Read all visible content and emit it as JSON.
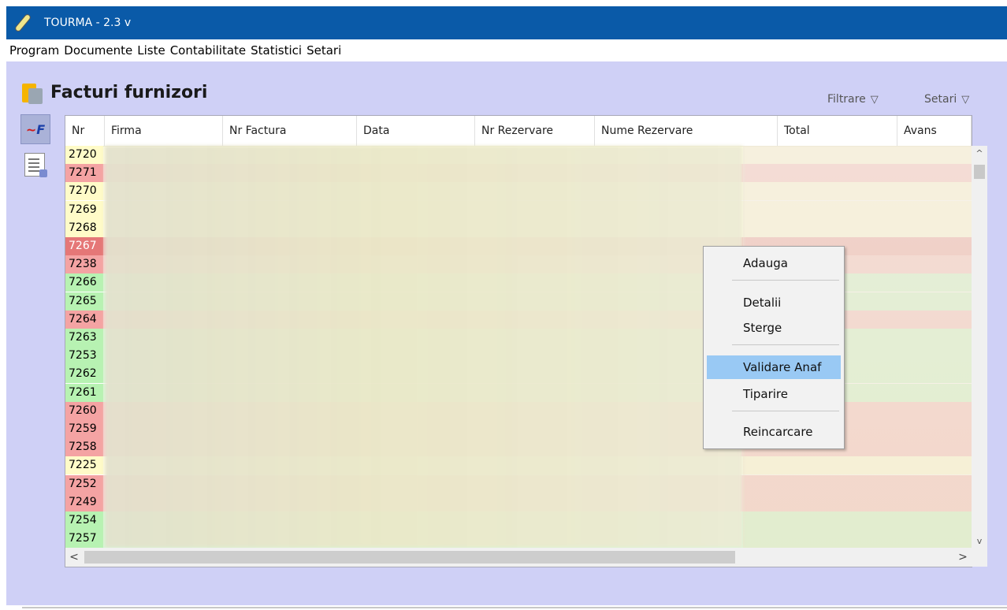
{
  "window": {
    "title": "TOURMA - 2.3 v",
    "icon": "feather-pen-icon"
  },
  "menubar": {
    "items": [
      "Program",
      "Documente",
      "Liste",
      "Contabilitate",
      "Statistici",
      "Setari"
    ]
  },
  "page": {
    "title": "Facturi furnizori",
    "title_icon": "folder-icon",
    "filter_label": "Filtrare",
    "settings_label": "Setari",
    "dropdown_glyph": "▽"
  },
  "sidebar": {
    "tools": [
      {
        "name": "anaf-logo-icon",
        "label": "AF"
      },
      {
        "name": "document-edit-icon"
      }
    ]
  },
  "table": {
    "columns": [
      "Nr",
      "Firma",
      "Nr Factura",
      "Data",
      "Nr Rezervare",
      "Nume Rezervare",
      "Total",
      "Avans"
    ],
    "rows": [
      {
        "nr": "2720",
        "status": "yellow"
      },
      {
        "nr": "7271",
        "status": "red"
      },
      {
        "nr": "7270",
        "status": "yellow"
      },
      {
        "nr": "7269",
        "status": "yellow"
      },
      {
        "nr": "7268",
        "status": "yellow"
      },
      {
        "nr": "7267",
        "status": "dark-red"
      },
      {
        "nr": "7238",
        "status": "red"
      },
      {
        "nr": "7266",
        "status": "green"
      },
      {
        "nr": "7265",
        "status": "green"
      },
      {
        "nr": "7264",
        "status": "red"
      },
      {
        "nr": "7263",
        "status": "green"
      },
      {
        "nr": "7253",
        "status": "green"
      },
      {
        "nr": "7262",
        "status": "green"
      },
      {
        "nr": "7261",
        "status": "green"
      },
      {
        "nr": "7260",
        "status": "red"
      },
      {
        "nr": "7259",
        "status": "red"
      },
      {
        "nr": "7258",
        "status": "red"
      },
      {
        "nr": "7225",
        "status": "yellow"
      },
      {
        "nr": "7252",
        "status": "red"
      },
      {
        "nr": "7249",
        "status": "red"
      },
      {
        "nr": "7254",
        "status": "green"
      },
      {
        "nr": "7257",
        "status": "green"
      }
    ]
  },
  "colors": {
    "yellow": "#fffbc8",
    "red": "#f4a3a3",
    "dark-red": "#e57777",
    "green": "#b7f2b2",
    "titlebar": "#0a5aa8",
    "background": "#cfd0f6",
    "selection": "#99c9f4"
  },
  "context_menu": {
    "items": [
      {
        "label": "Adauga"
      },
      {
        "label": "Detalii"
      },
      {
        "label": "Sterge"
      },
      {
        "label": "Validare Anaf",
        "selected": true
      },
      {
        "label": "Tiparire"
      },
      {
        "label": "Reincarcare"
      }
    ]
  },
  "scrollbar": {
    "up": "^",
    "down": "v",
    "left": "<",
    "right": ">"
  }
}
